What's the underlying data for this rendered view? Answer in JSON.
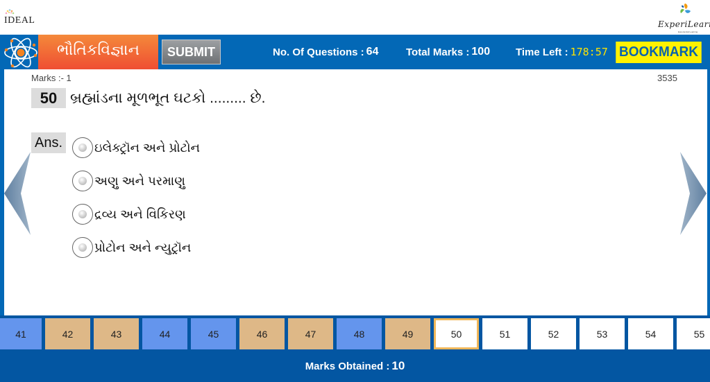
{
  "branding": {
    "left_logo": "IDEAL",
    "right_logo": "ExperiLearn",
    "right_logo_tagline": "Experiential Learning"
  },
  "header": {
    "subject": "ભૌતિકવિજ્ઞાન",
    "submit_label": "SUBMIT",
    "questions_label": "No. Of Questions :",
    "questions_value": "64",
    "total_marks_label": "Total Marks :",
    "total_marks_value": "100",
    "time_left_label": "Time Left :",
    "time_left_value": "178:57",
    "bookmark_label": "BOOKMARK"
  },
  "question": {
    "marks_label": "Marks :- 1",
    "id": "3535",
    "number": "50",
    "text": "બ્રહ્માંડના મૂળભૂત ઘટકો ......... છે.",
    "answer_label": "Ans.",
    "options": [
      {
        "text": "ઇલેક્ટ્રૉન અને પ્રોટોન",
        "selected": false
      },
      {
        "text": "અણુ અને પરમાણુ",
        "selected": false
      },
      {
        "text": "દ્રવ્ય અને વિકિરણ",
        "selected": false
      },
      {
        "text": "પ્રોટોન અને ન્યુટ્રૉન",
        "selected": false
      }
    ]
  },
  "navigation": {
    "prev_icon": "chevron-left-icon",
    "next_icon": "chevron-right-icon"
  },
  "question_strip": [
    {
      "number": "41",
      "status": "answered"
    },
    {
      "number": "42",
      "status": "bookmarked"
    },
    {
      "number": "43",
      "status": "bookmarked"
    },
    {
      "number": "44",
      "status": "answered"
    },
    {
      "number": "45",
      "status": "answered"
    },
    {
      "number": "46",
      "status": "bookmarked"
    },
    {
      "number": "47",
      "status": "bookmarked"
    },
    {
      "number": "48",
      "status": "answered"
    },
    {
      "number": "49",
      "status": "bookmarked"
    },
    {
      "number": "50",
      "status": "current"
    },
    {
      "number": "51",
      "status": "unvisited"
    },
    {
      "number": "52",
      "status": "unvisited"
    },
    {
      "number": "53",
      "status": "unvisited"
    },
    {
      "number": "54",
      "status": "unvisited"
    },
    {
      "number": "55",
      "status": "unvisited"
    }
  ],
  "status_colors": {
    "answered": "#6495ed",
    "bookmarked": "#deb887",
    "unvisited": "#ffffff",
    "current_border": "#f0b75a",
    "header_blue": "#0368b6",
    "bookmark_yellow": "#fff200",
    "timer_yellow": "#ffe400"
  },
  "footer": {
    "marks_obtained_label": "Marks Obtained :",
    "marks_obtained_value": "10"
  }
}
